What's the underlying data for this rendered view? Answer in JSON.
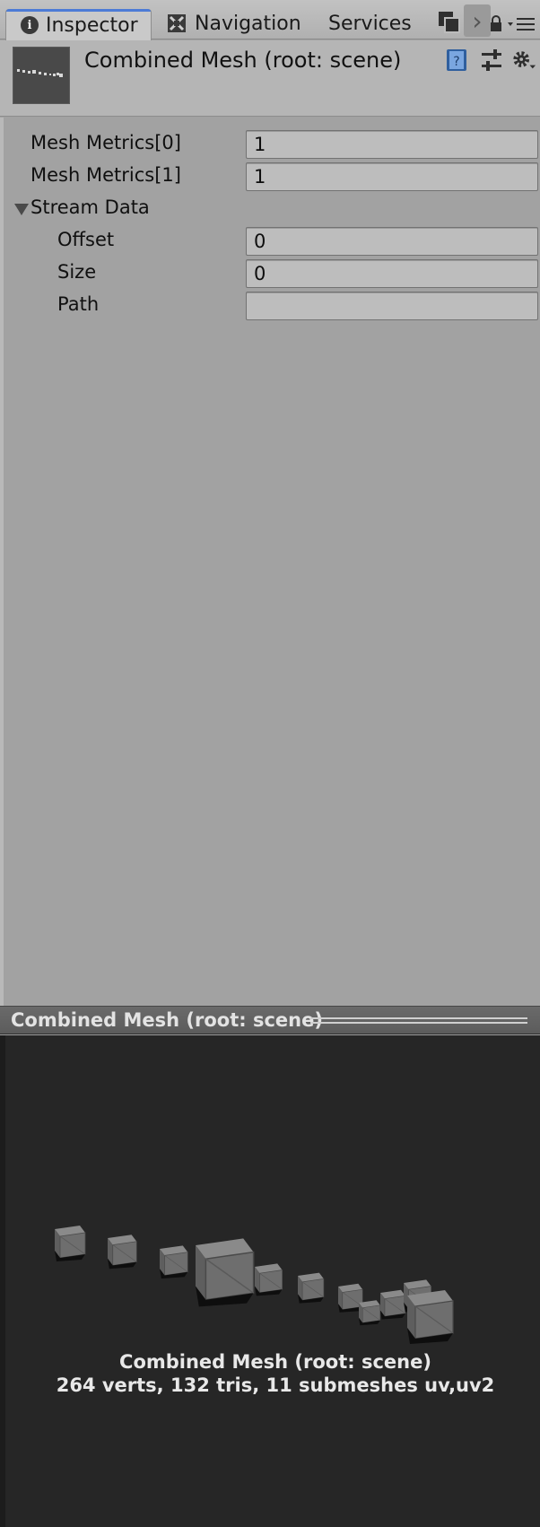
{
  "tabs": [
    {
      "label": "Inspector",
      "icon": "info-icon",
      "active": true
    },
    {
      "label": "Navigation",
      "icon": "navigation-icon",
      "active": false
    },
    {
      "label": "Services",
      "icon": "",
      "active": false
    }
  ],
  "asset": {
    "title": "Combined Mesh (root: scene)"
  },
  "properties": {
    "mesh_metrics_0": {
      "label": "Mesh Metrics[0]",
      "value": "1"
    },
    "mesh_metrics_1": {
      "label": "Mesh Metrics[1]",
      "value": "1"
    },
    "stream_data": {
      "label": "Stream Data",
      "expanded": true,
      "offset": {
        "label": "Offset",
        "value": "0"
      },
      "size": {
        "label": "Size",
        "value": "0"
      },
      "path": {
        "label": "Path",
        "value": ""
      }
    }
  },
  "preview": {
    "title": "Combined Mesh (root: scene)",
    "caption_name": "Combined Mesh (root: scene)",
    "caption_stats": "264 verts, 132 tris, 11 submeshes   uv,uv2"
  },
  "colors": {
    "accent": "#4c7bd6",
    "panel": "#a2a2a2",
    "preview_bg": "#262626"
  }
}
